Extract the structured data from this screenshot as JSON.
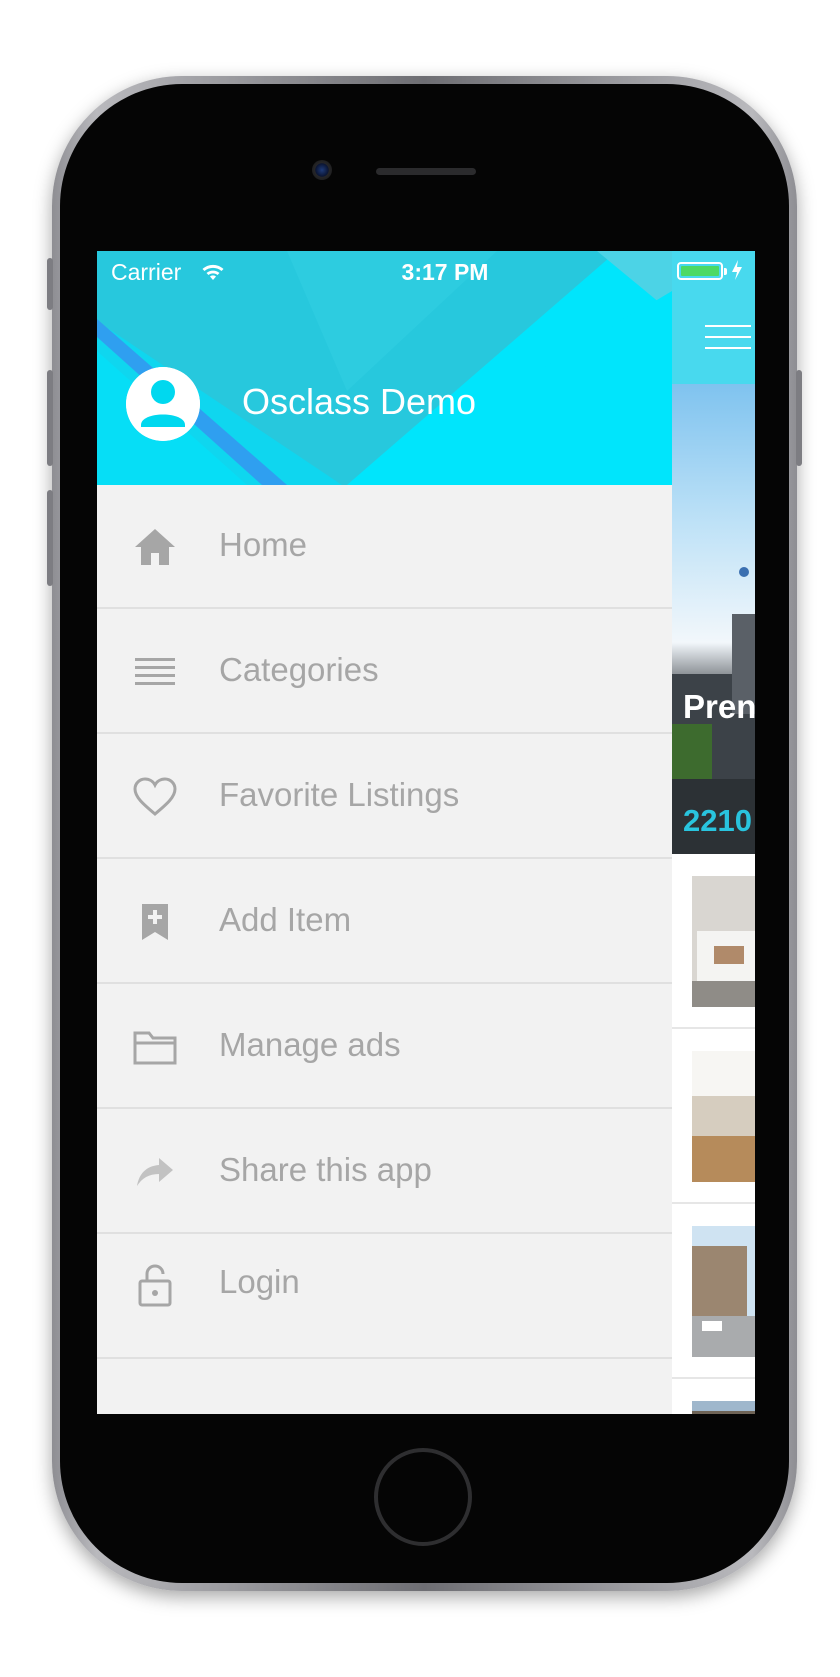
{
  "status_bar": {
    "carrier": "Carrier",
    "time": "3:17 PM"
  },
  "drawer": {
    "app_title": "Osclass Demo",
    "header_color": "#00e5fc",
    "items": [
      {
        "label": "Home",
        "icon": "home-icon"
      },
      {
        "label": "Categories",
        "icon": "list-icon"
      },
      {
        "label": "Favorite Listings",
        "icon": "heart-icon"
      },
      {
        "label": "Add Item",
        "icon": "bookmark-add-icon"
      },
      {
        "label": "Manage ads",
        "icon": "folder-icon"
      },
      {
        "label": "Share this app",
        "icon": "share-icon"
      },
      {
        "label": "Login",
        "icon": "lock-open-icon"
      }
    ]
  },
  "main": {
    "header_color": "#48d9ee",
    "featured_title": "Pren",
    "featured_price": "2210",
    "accent_color": "#29c4de"
  }
}
